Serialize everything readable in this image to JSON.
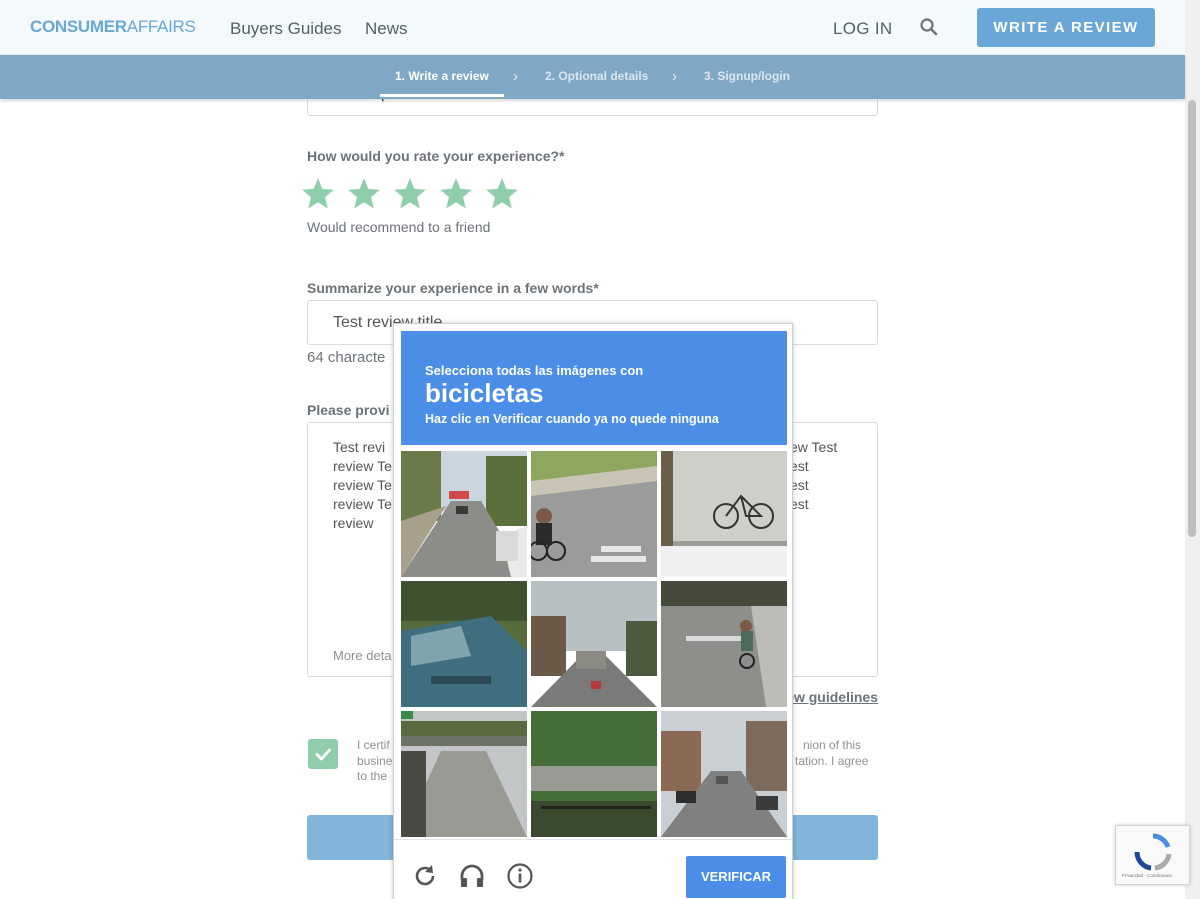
{
  "header": {
    "logo_bold": "CONSUMER",
    "logo_light": "AFFAIRS",
    "nav": [
      "Buyers Guides",
      "News"
    ],
    "login": "LOG IN",
    "write_review": "WRITE A REVIEW"
  },
  "steps": [
    "1. Write a review",
    "2. Optional details",
    "3. Signup/login"
  ],
  "form": {
    "department_value": "test department",
    "rating_label": "How would you rate your experience?*",
    "rating_value": "5/5",
    "rating_caption": "Would recommend to a friend",
    "summary_label": "Summarize your experience in a few words*",
    "summary_value": "Test review title",
    "char_count": "64 characte",
    "details_label": "Please provi",
    "review_lines": [
      "Test revi",
      "review Te",
      "review Te",
      "review Te",
      "review"
    ],
    "review_lines_right": [
      "ew Test",
      "est",
      "est",
      "est"
    ],
    "more_details": "More deta",
    "guidelines": "ew guidelines",
    "certify_left": [
      "I certif",
      "busine",
      "to the"
    ],
    "certify_right": [
      "nion of this",
      "tation. I agree"
    ]
  },
  "captcha": {
    "line1": "Selecciona todas las imágenes con",
    "keyword": "bicicletas",
    "line3": "Haz clic en Verificar cuando ya no quede ninguna",
    "verify": "VERIFICAR",
    "icons": [
      "reload-icon",
      "audio-icon",
      "info-icon"
    ]
  },
  "badge": {
    "text": "Privacidad - Condiciones"
  },
  "colors": {
    "accent": "#6aa7d6",
    "stepbar": "#7fa8c6",
    "star": "#8fceaa",
    "captcha_blue": "#4a8ee8"
  }
}
